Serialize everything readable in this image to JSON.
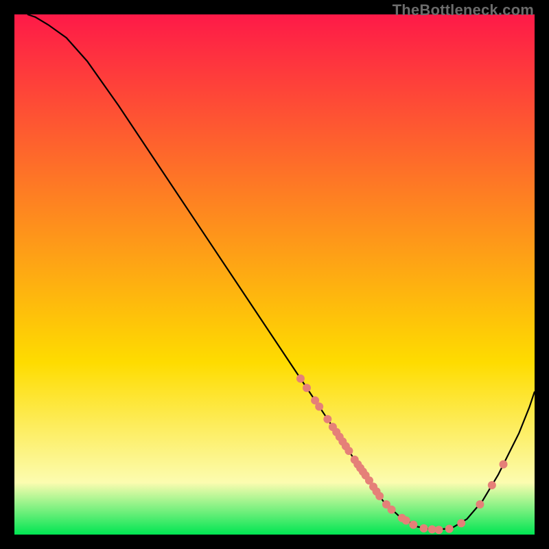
{
  "watermark": "TheBottleneck.com",
  "colors": {
    "gradient_top": "#fe1a48",
    "gradient_yellow": "#fedc00",
    "gradient_lightyellow": "#fcfcb0",
    "gradient_green": "#00e552",
    "curve_stroke": "#000000",
    "dot_fill": "#e58078",
    "background": "#000000"
  },
  "chart_data": {
    "type": "line",
    "title": "",
    "xlabel": "",
    "ylabel": "",
    "xlim": [
      0,
      100
    ],
    "ylim": [
      0,
      100
    ],
    "curve": [
      {
        "x": 2.5,
        "y": 100
      },
      {
        "x": 4.0,
        "y": 99.5
      },
      {
        "x": 6.5,
        "y": 98.0
      },
      {
        "x": 10.0,
        "y": 95.5
      },
      {
        "x": 14.0,
        "y": 91.0
      },
      {
        "x": 20.0,
        "y": 82.5
      },
      {
        "x": 28.0,
        "y": 70.5
      },
      {
        "x": 36.0,
        "y": 58.5
      },
      {
        "x": 44.0,
        "y": 46.5
      },
      {
        "x": 52.0,
        "y": 34.5
      },
      {
        "x": 57.0,
        "y": 27.0
      },
      {
        "x": 61.0,
        "y": 21.0
      },
      {
        "x": 65.0,
        "y": 15.0
      },
      {
        "x": 68.0,
        "y": 10.5
      },
      {
        "x": 71.0,
        "y": 6.3
      },
      {
        "x": 74.0,
        "y": 3.5
      },
      {
        "x": 77.5,
        "y": 1.5
      },
      {
        "x": 80.5,
        "y": 0.9
      },
      {
        "x": 84.0,
        "y": 1.2
      },
      {
        "x": 87.0,
        "y": 3.0
      },
      {
        "x": 90.0,
        "y": 6.5
      },
      {
        "x": 93.0,
        "y": 11.5
      },
      {
        "x": 95.0,
        "y": 15.5
      },
      {
        "x": 97.0,
        "y": 19.5
      },
      {
        "x": 99.0,
        "y": 24.5
      },
      {
        "x": 100.0,
        "y": 27.5
      }
    ],
    "dots": [
      {
        "x": 55.0,
        "y": 30.0
      },
      {
        "x": 56.2,
        "y": 28.2
      },
      {
        "x": 57.8,
        "y": 25.8
      },
      {
        "x": 58.6,
        "y": 24.6
      },
      {
        "x": 60.2,
        "y": 22.2
      },
      {
        "x": 61.2,
        "y": 20.7
      },
      {
        "x": 61.9,
        "y": 19.7
      },
      {
        "x": 62.5,
        "y": 18.8
      },
      {
        "x": 63.1,
        "y": 17.9
      },
      {
        "x": 63.7,
        "y": 17.0
      },
      {
        "x": 64.3,
        "y": 16.1
      },
      {
        "x": 65.4,
        "y": 14.4
      },
      {
        "x": 66.0,
        "y": 13.5
      },
      {
        "x": 66.5,
        "y": 12.8
      },
      {
        "x": 67.0,
        "y": 12.1
      },
      {
        "x": 67.5,
        "y": 11.4
      },
      {
        "x": 68.2,
        "y": 10.4
      },
      {
        "x": 69.0,
        "y": 9.2
      },
      {
        "x": 69.6,
        "y": 8.3
      },
      {
        "x": 70.2,
        "y": 7.4
      },
      {
        "x": 71.5,
        "y": 5.8
      },
      {
        "x": 72.5,
        "y": 4.8
      },
      {
        "x": 74.5,
        "y": 3.2
      },
      {
        "x": 75.3,
        "y": 2.7
      },
      {
        "x": 76.7,
        "y": 1.9
      },
      {
        "x": 78.7,
        "y": 1.2
      },
      {
        "x": 80.3,
        "y": 1.0
      },
      {
        "x": 81.6,
        "y": 0.9
      },
      {
        "x": 83.6,
        "y": 1.1
      },
      {
        "x": 85.9,
        "y": 2.2
      },
      {
        "x": 89.5,
        "y": 5.8
      },
      {
        "x": 91.8,
        "y": 9.5
      },
      {
        "x": 94.0,
        "y": 13.5
      }
    ]
  }
}
